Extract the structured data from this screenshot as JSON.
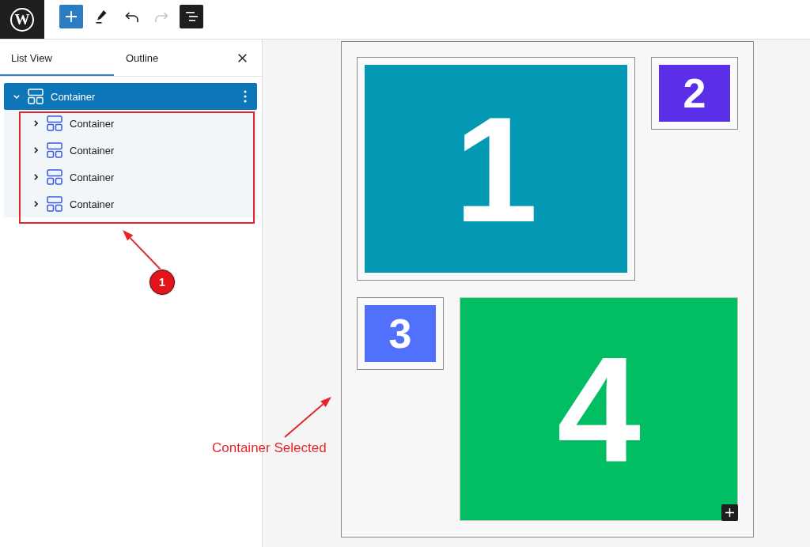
{
  "toolbar": {
    "logo": "W",
    "buttons": [
      {
        "kind": "add",
        "pressed": false,
        "disabled": false
      },
      {
        "kind": "tools",
        "pressed": false,
        "disabled": false
      },
      {
        "kind": "undo",
        "pressed": false,
        "disabled": false
      },
      {
        "kind": "redo",
        "pressed": false,
        "disabled": true
      },
      {
        "kind": "list-view",
        "pressed": true,
        "disabled": false
      }
    ]
  },
  "sidebar": {
    "tabs": [
      {
        "label": "List View",
        "selected": true
      },
      {
        "label": "Outline",
        "selected": false
      }
    ],
    "tree": [
      {
        "label": "Container",
        "selected": true,
        "expanded": true,
        "children": [
          {
            "label": "Container",
            "selected": false,
            "expanded": false
          },
          {
            "label": "Container",
            "selected": false,
            "expanded": false
          },
          {
            "label": "Container",
            "selected": false,
            "expanded": false
          },
          {
            "label": "Container",
            "selected": false,
            "expanded": false
          }
        ]
      }
    ]
  },
  "canvas": {
    "rows": [
      {
        "blocks": [
          {
            "label": "1",
            "color": "#0399b4",
            "kind": "large",
            "appender": false
          },
          {
            "label": "2",
            "color": "#5b2ee8",
            "kind": "small",
            "appender": false
          }
        ]
      },
      {
        "blocks": [
          {
            "label": "3",
            "color": "#5170fb",
            "kind": "small",
            "appender": false
          },
          {
            "label": "4",
            "color": "#00be61",
            "kind": "filled",
            "appender": true
          }
        ]
      }
    ]
  },
  "annotations": [
    {
      "kind": "step",
      "label": "1"
    },
    {
      "kind": "callout",
      "label": "Container Selected"
    }
  ]
}
